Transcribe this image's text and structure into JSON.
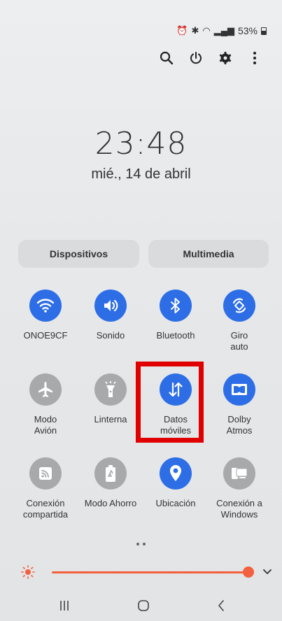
{
  "status_bar": {
    "battery_percent": "53%"
  },
  "clock": {
    "time": "23:48",
    "date": "mié., 14 de abril"
  },
  "tabs": {
    "devices": "Dispositivos",
    "media": "Multimedia"
  },
  "tiles": [
    {
      "label": "ONOE9CF",
      "state": "on",
      "icon": "wifi-icon"
    },
    {
      "label": "Sonido",
      "state": "on",
      "icon": "sound-icon"
    },
    {
      "label": "Bluetooth",
      "state": "on",
      "icon": "bluetooth-icon"
    },
    {
      "label": "Giro\nauto",
      "state": "on",
      "icon": "rotate-icon"
    },
    {
      "label": "Modo\nAvión",
      "state": "off",
      "icon": "airplane-icon"
    },
    {
      "label": "Linterna",
      "state": "off",
      "icon": "flashlight-icon"
    },
    {
      "label": "Datos\nmóviles",
      "state": "on",
      "icon": "mobile-data-icon"
    },
    {
      "label": "Dolby\nAtmos",
      "state": "on",
      "icon": "dolby-icon"
    },
    {
      "label": "Conexión\ncompartida",
      "state": "off",
      "icon": "hotspot-icon"
    },
    {
      "label": "Modo Ahorro",
      "state": "off",
      "icon": "battery-saver-icon"
    },
    {
      "label": "Ubicación",
      "state": "on",
      "icon": "location-icon"
    },
    {
      "label": "Conexión a\nWindows",
      "state": "off",
      "icon": "link-windows-icon"
    }
  ],
  "brightness": {
    "level": 0.93
  },
  "colors": {
    "accent": "#2d6ee6",
    "off": "#a7a9ab",
    "brightness": "#f2603e",
    "highlight": "#e10000"
  }
}
